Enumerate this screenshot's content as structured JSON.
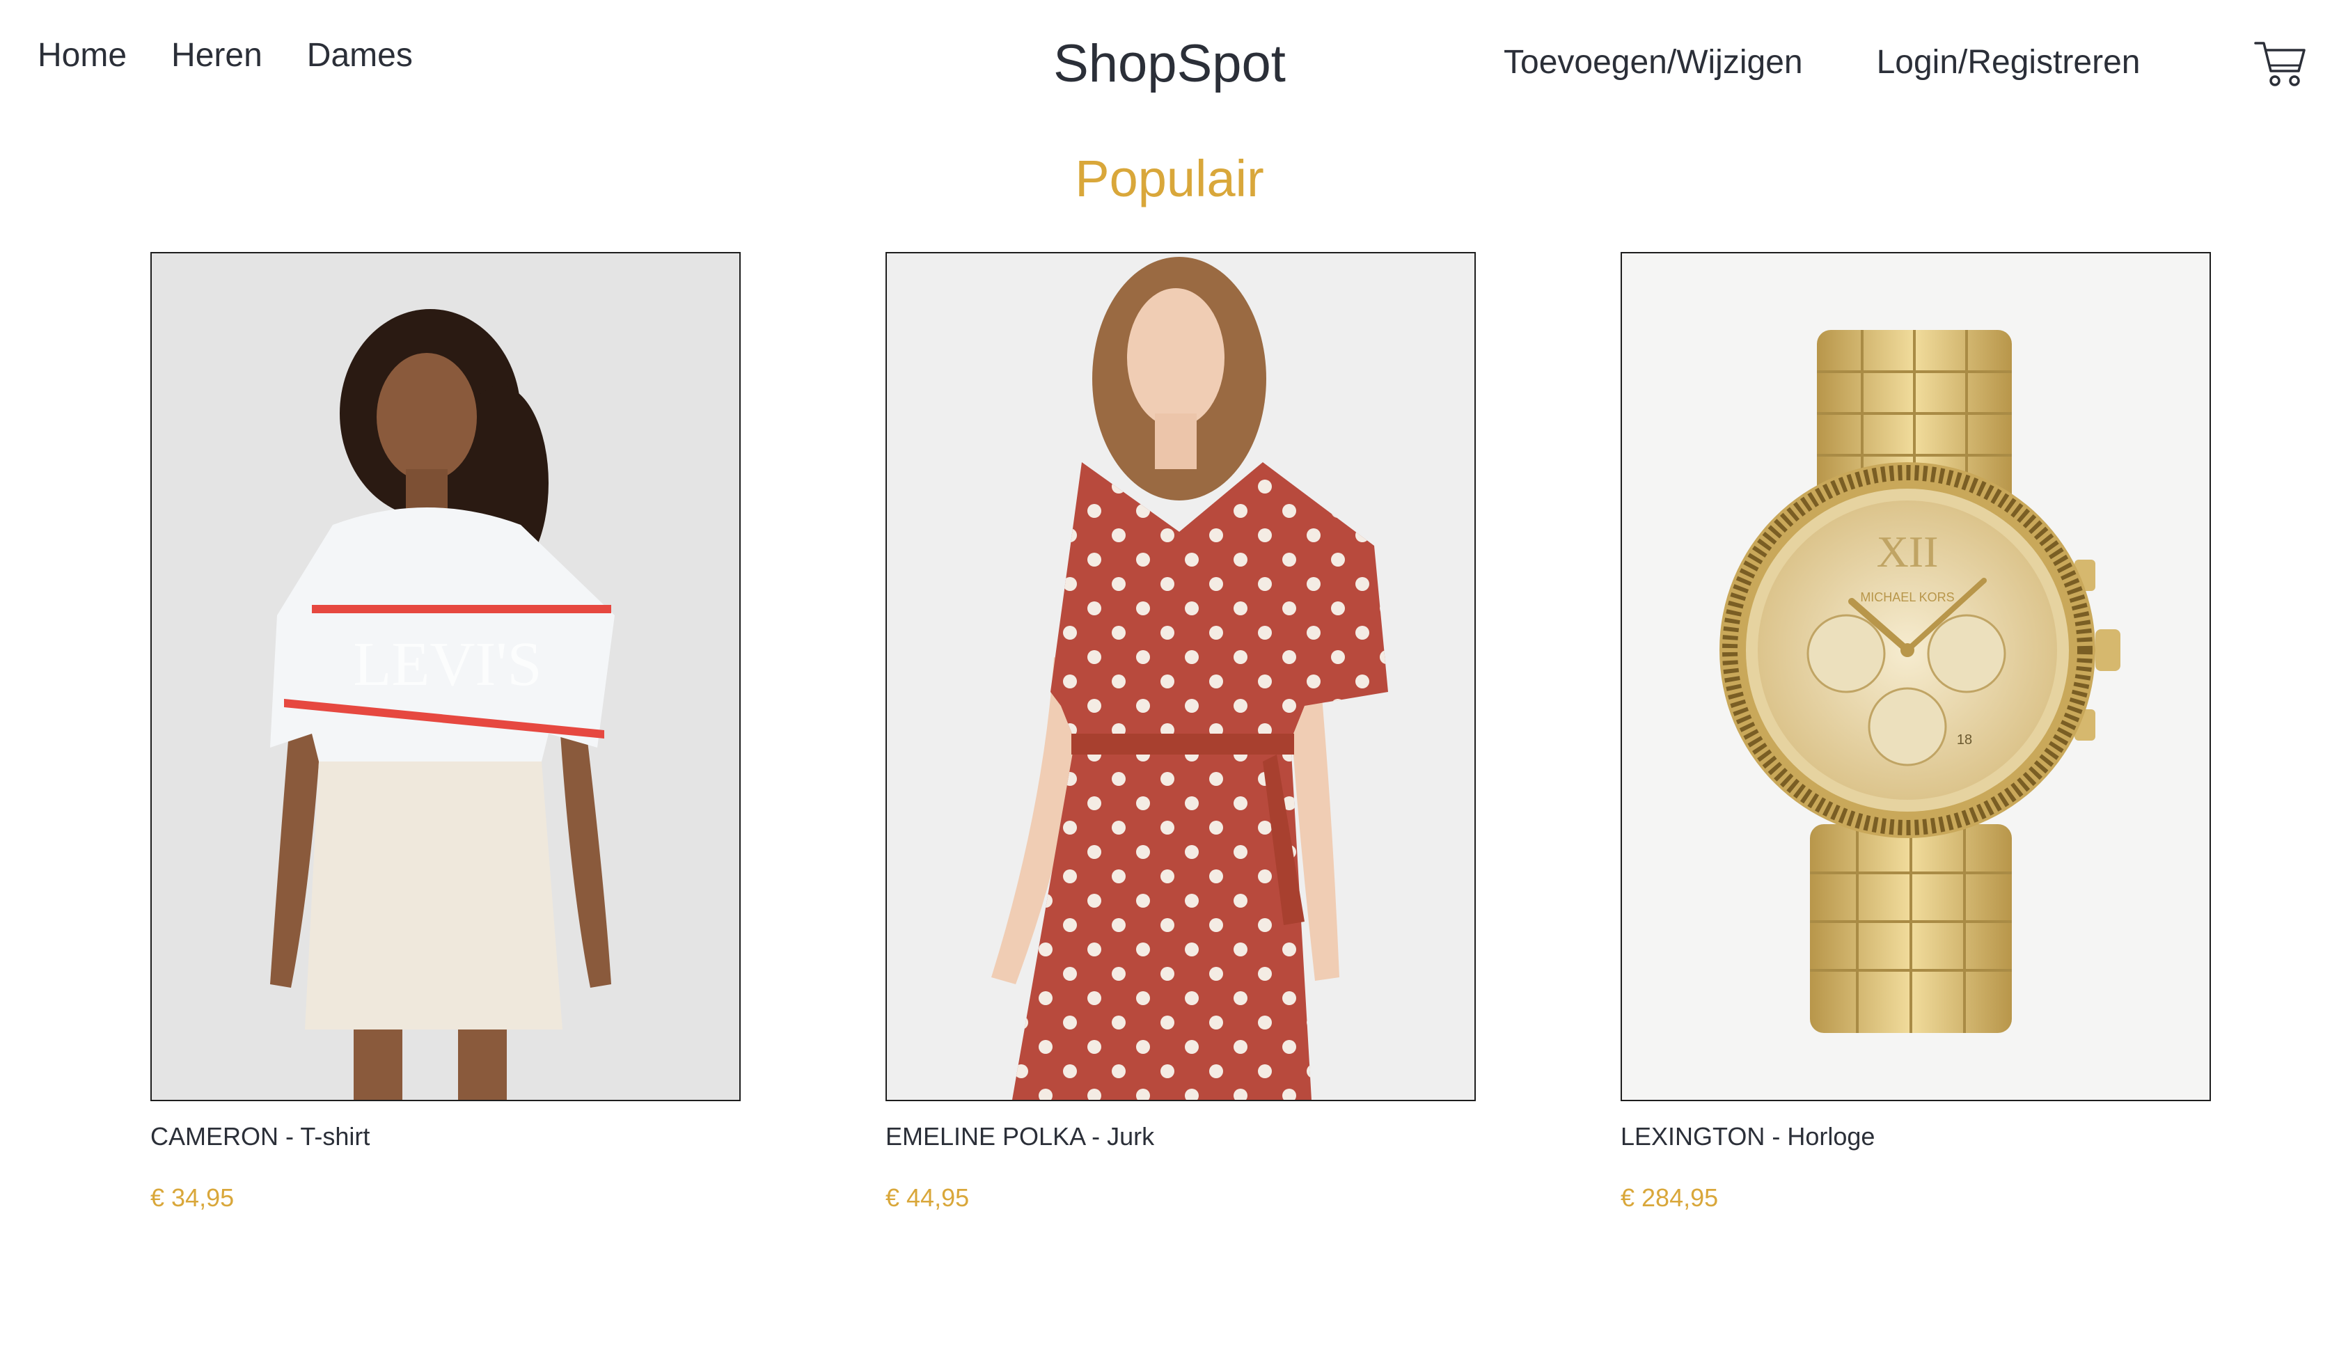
{
  "header": {
    "nav_left": [
      "Home",
      "Heren",
      "Dames"
    ],
    "brand": "ShopSpot",
    "nav_right": [
      "Toevoegen/Wijzigen",
      "Login/Registreren"
    ],
    "cart_icon": "shopping-cart-icon"
  },
  "section": {
    "title": "Populair"
  },
  "products": [
    {
      "name": "CAMERON - T-shirt",
      "price": "€ 34,95",
      "image": "woman-in-striped-tshirt-and-white-skirt"
    },
    {
      "name": "EMELINE POLKA - Jurk",
      "price": "€ 44,95",
      "image": "woman-in-red-polka-dot-dress"
    },
    {
      "name": "LEXINGTON - Horloge",
      "price": "€ 284,95",
      "image": "gold-chronograph-watch"
    }
  ],
  "image_text": {
    "tshirt_logo": "LEVI'S",
    "watch_brand": "MICHAEL KORS",
    "watch_numeral": "XII",
    "watch_date": "18"
  },
  "colors": {
    "accent": "#d9a73a",
    "text": "#2b2f38"
  }
}
